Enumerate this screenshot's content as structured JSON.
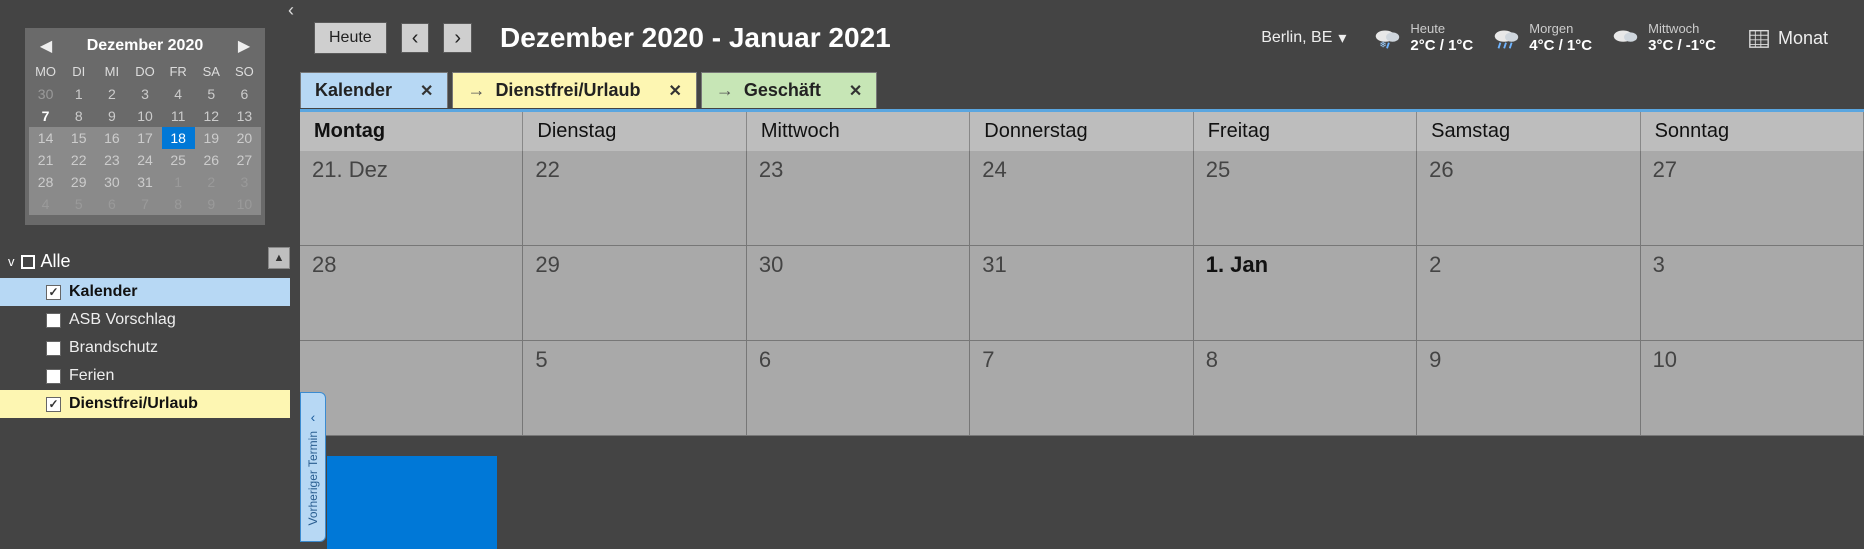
{
  "collapse_glyph": "‹",
  "minical": {
    "title": "Dezember 2020",
    "prev": "◀",
    "next": "▶",
    "dow": [
      "MO",
      "DI",
      "MI",
      "DO",
      "FR",
      "SA",
      "SO"
    ],
    "rows": [
      {
        "shade": false,
        "days": [
          {
            "n": "30",
            "cls": "dim"
          },
          {
            "n": "1",
            "cls": ""
          },
          {
            "n": "2",
            "cls": ""
          },
          {
            "n": "3",
            "cls": ""
          },
          {
            "n": "4",
            "cls": ""
          },
          {
            "n": "5",
            "cls": ""
          },
          {
            "n": "6",
            "cls": ""
          }
        ]
      },
      {
        "shade": false,
        "days": [
          {
            "n": "7",
            "cls": "bold"
          },
          {
            "n": "8",
            "cls": ""
          },
          {
            "n": "9",
            "cls": ""
          },
          {
            "n": "10",
            "cls": ""
          },
          {
            "n": "11",
            "cls": ""
          },
          {
            "n": "12",
            "cls": ""
          },
          {
            "n": "13",
            "cls": ""
          }
        ]
      },
      {
        "shade": true,
        "days": [
          {
            "n": "14",
            "cls": ""
          },
          {
            "n": "15",
            "cls": ""
          },
          {
            "n": "16",
            "cls": ""
          },
          {
            "n": "17",
            "cls": ""
          },
          {
            "n": "18",
            "cls": "hl"
          },
          {
            "n": "19",
            "cls": ""
          },
          {
            "n": "20",
            "cls": ""
          }
        ]
      },
      {
        "shade": true,
        "days": [
          {
            "n": "21",
            "cls": ""
          },
          {
            "n": "22",
            "cls": ""
          },
          {
            "n": "23",
            "cls": ""
          },
          {
            "n": "24",
            "cls": ""
          },
          {
            "n": "25",
            "cls": ""
          },
          {
            "n": "26",
            "cls": ""
          },
          {
            "n": "27",
            "cls": ""
          }
        ]
      },
      {
        "shade": true,
        "days": [
          {
            "n": "28",
            "cls": ""
          },
          {
            "n": "29",
            "cls": ""
          },
          {
            "n": "30",
            "cls": ""
          },
          {
            "n": "31",
            "cls": ""
          },
          {
            "n": "1",
            "cls": "dim"
          },
          {
            "n": "2",
            "cls": "dim"
          },
          {
            "n": "3",
            "cls": "dim"
          }
        ]
      },
      {
        "shade": true,
        "days": [
          {
            "n": "4",
            "cls": "dim"
          },
          {
            "n": "5",
            "cls": "dim"
          },
          {
            "n": "6",
            "cls": "dim"
          },
          {
            "n": "7",
            "cls": "dim"
          },
          {
            "n": "8",
            "cls": "dim"
          },
          {
            "n": "9",
            "cls": "dim"
          },
          {
            "n": "10",
            "cls": "dim"
          }
        ]
      }
    ]
  },
  "cal_list": {
    "head_chev": "v",
    "head_label": "Alle",
    "scroll_up": "▲",
    "items": [
      {
        "label": "Kalender",
        "checked": true,
        "cls": "kalender"
      },
      {
        "label": "ASB Vorschlag",
        "checked": false,
        "cls": "plain"
      },
      {
        "label": "Brandschutz",
        "checked": false,
        "cls": "plain"
      },
      {
        "label": "Ferien",
        "checked": false,
        "cls": "plain"
      },
      {
        "label": "Dienstfrei/Urlaub",
        "checked": true,
        "cls": "dienstfrei"
      }
    ]
  },
  "toolbar": {
    "today": "Heute",
    "prev": "‹",
    "next": "›",
    "title": "Dezember 2020 - Januar 2021",
    "location": "Berlin, BE",
    "loc_caret": "▾",
    "view_label": "Monat"
  },
  "weather": [
    {
      "label": "Heute",
      "temp": "2°C / 1°C",
      "icon": "rain-snow"
    },
    {
      "label": "Morgen",
      "temp": "4°C / 1°C",
      "icon": "rain"
    },
    {
      "label": "Mittwoch",
      "temp": "3°C / -1°C",
      "icon": "cloud"
    }
  ],
  "tabs": [
    {
      "label": "Kalender",
      "cls": "kalender",
      "arrow": false
    },
    {
      "label": "Dienstfrei/Urlaub",
      "cls": "dienstfrei",
      "arrow": true
    },
    {
      "label": "Geschäft",
      "cls": "geschaeft",
      "arrow": true
    }
  ],
  "close_glyph": "✕",
  "arrow_glyph": "→",
  "dow": [
    {
      "label": "Montag",
      "bold": true
    },
    {
      "label": "Dienstag",
      "bold": false
    },
    {
      "label": "Mittwoch",
      "bold": false
    },
    {
      "label": "Donnerstag",
      "bold": false
    },
    {
      "label": "Freitag",
      "bold": false
    },
    {
      "label": "Samstag",
      "bold": false
    },
    {
      "label": "Sonntag",
      "bold": false
    }
  ],
  "weeks": [
    [
      {
        "n": "21. Dez",
        "bold": false
      },
      {
        "n": "22"
      },
      {
        "n": "23"
      },
      {
        "n": "24"
      },
      {
        "n": "25"
      },
      {
        "n": "26"
      },
      {
        "n": "27"
      }
    ],
    [
      {
        "n": "28"
      },
      {
        "n": "29"
      },
      {
        "n": "30"
      },
      {
        "n": "31"
      },
      {
        "n": "1. Jan",
        "bold": true
      },
      {
        "n": "2"
      },
      {
        "n": "3"
      }
    ],
    [
      {
        "n": ""
      },
      {
        "n": "5"
      },
      {
        "n": "6"
      },
      {
        "n": "7"
      },
      {
        "n": "8"
      },
      {
        "n": "9"
      },
      {
        "n": "10"
      }
    ]
  ],
  "prev_handle": {
    "chev": "‹",
    "label": "Vorheriger Termin"
  }
}
